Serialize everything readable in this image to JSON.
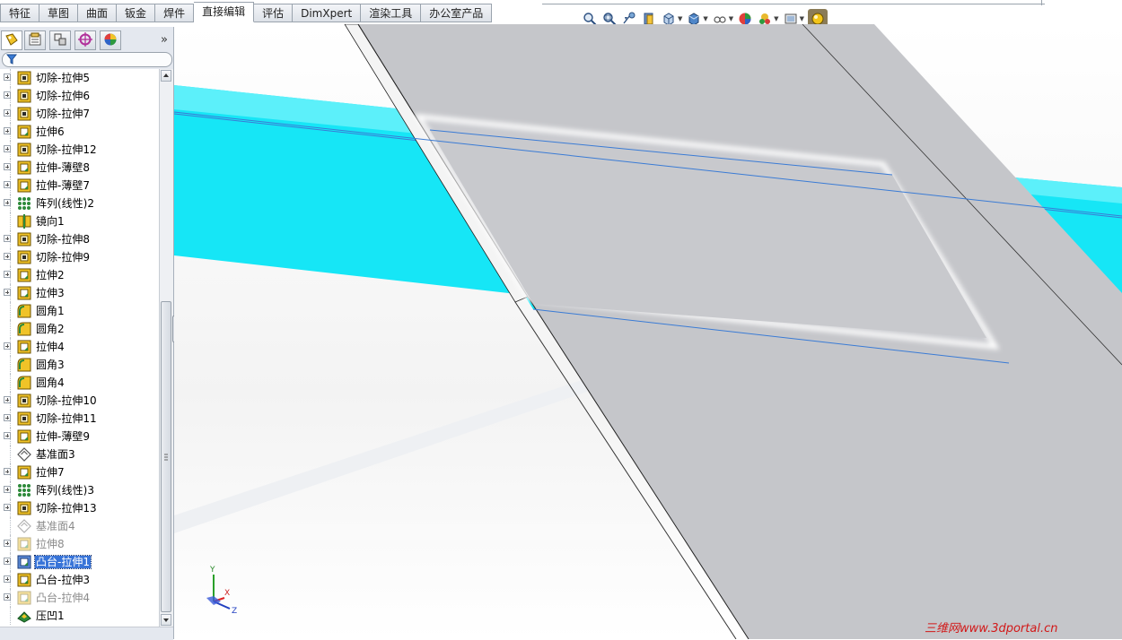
{
  "command_tabs": [
    {
      "label": "特征",
      "active": false
    },
    {
      "label": "草图",
      "active": false
    },
    {
      "label": "曲面",
      "active": false
    },
    {
      "label": "钣金",
      "active": false
    },
    {
      "label": "焊件",
      "active": false
    },
    {
      "label": "直接编辑",
      "active": true
    },
    {
      "label": "评估",
      "active": false
    },
    {
      "label": "DimXpert",
      "active": false
    },
    {
      "label": "渲染工具",
      "active": false
    },
    {
      "label": "办公室产品",
      "active": false
    }
  ],
  "view_toolbar": [
    "zoom-to-fit-icon",
    "zoom-to-area-icon",
    "previous-view-icon",
    "section-view-icon",
    "view-orientation-icon",
    "display-style-icon",
    "hide-show-items-icon",
    "edit-appearance-icon",
    "apply-scene-icon",
    "view-settings-icon",
    "realview-icon"
  ],
  "pane_tabs": [
    "featuremanager-icon",
    "propertymanager-icon",
    "configurationmanager-icon",
    "dimxpert-manager-icon",
    "display-manager-icon"
  ],
  "pane_more": "»",
  "tree": [
    {
      "label": "切除-拉伸5",
      "icon": "cut-extrude",
      "expand": true,
      "dim": false,
      "selected": false
    },
    {
      "label": "切除-拉伸6",
      "icon": "cut-extrude",
      "expand": true,
      "dim": false,
      "selected": false
    },
    {
      "label": "切除-拉伸7",
      "icon": "cut-extrude",
      "expand": true,
      "dim": false,
      "selected": false
    },
    {
      "label": "拉伸6",
      "icon": "extrude",
      "expand": true,
      "dim": false,
      "selected": false
    },
    {
      "label": "切除-拉伸12",
      "icon": "cut-extrude",
      "expand": true,
      "dim": false,
      "selected": false
    },
    {
      "label": "拉伸-薄壁8",
      "icon": "extrude",
      "expand": true,
      "dim": false,
      "selected": false
    },
    {
      "label": "拉伸-薄壁7",
      "icon": "extrude",
      "expand": true,
      "dim": false,
      "selected": false
    },
    {
      "label": "阵列(线性)2",
      "icon": "linear-pattern",
      "expand": true,
      "dim": false,
      "selected": false
    },
    {
      "label": "镜向1",
      "icon": "mirror",
      "expand": false,
      "dim": false,
      "selected": false
    },
    {
      "label": "切除-拉伸8",
      "icon": "cut-extrude",
      "expand": true,
      "dim": false,
      "selected": false
    },
    {
      "label": "切除-拉伸9",
      "icon": "cut-extrude",
      "expand": true,
      "dim": false,
      "selected": false
    },
    {
      "label": "拉伸2",
      "icon": "extrude",
      "expand": true,
      "dim": false,
      "selected": false
    },
    {
      "label": "拉伸3",
      "icon": "extrude",
      "expand": true,
      "dim": false,
      "selected": false
    },
    {
      "label": "圆角1",
      "icon": "fillet",
      "expand": false,
      "dim": false,
      "selected": false
    },
    {
      "label": "圆角2",
      "icon": "fillet",
      "expand": false,
      "dim": false,
      "selected": false
    },
    {
      "label": "拉伸4",
      "icon": "extrude",
      "expand": true,
      "dim": false,
      "selected": false
    },
    {
      "label": "圆角3",
      "icon": "fillet",
      "expand": false,
      "dim": false,
      "selected": false
    },
    {
      "label": "圆角4",
      "icon": "fillet",
      "expand": false,
      "dim": false,
      "selected": false
    },
    {
      "label": "切除-拉伸10",
      "icon": "cut-extrude",
      "expand": true,
      "dim": false,
      "selected": false
    },
    {
      "label": "切除-拉伸11",
      "icon": "cut-extrude",
      "expand": true,
      "dim": false,
      "selected": false
    },
    {
      "label": "拉伸-薄壁9",
      "icon": "extrude",
      "expand": true,
      "dim": false,
      "selected": false
    },
    {
      "label": "基准面3",
      "icon": "plane",
      "expand": false,
      "dim": false,
      "selected": false
    },
    {
      "label": "拉伸7",
      "icon": "extrude",
      "expand": true,
      "dim": false,
      "selected": false
    },
    {
      "label": "阵列(线性)3",
      "icon": "linear-pattern",
      "expand": true,
      "dim": false,
      "selected": false
    },
    {
      "label": "切除-拉伸13",
      "icon": "cut-extrude",
      "expand": true,
      "dim": false,
      "selected": false
    },
    {
      "label": "基准面4",
      "icon": "plane",
      "expand": false,
      "dim": true,
      "selected": false
    },
    {
      "label": "拉伸8",
      "icon": "extrude",
      "expand": true,
      "dim": true,
      "selected": false
    },
    {
      "label": "凸台-拉伸1",
      "icon": "boss-extrude",
      "expand": true,
      "dim": false,
      "selected": true
    },
    {
      "label": "凸台-拉伸3",
      "icon": "extrude",
      "expand": true,
      "dim": false,
      "selected": false
    },
    {
      "label": "凸台-拉伸4",
      "icon": "extrude",
      "expand": true,
      "dim": true,
      "selected": false
    },
    {
      "label": "压凹1",
      "icon": "indent",
      "expand": false,
      "dim": false,
      "selected": false
    }
  ],
  "triad_labels": {
    "x": "X",
    "y": "Y",
    "z": "Z"
  },
  "watermark": "三维网www.3dportal.cn",
  "colors": {
    "cyan_band": "#16e6f6",
    "gray_plate": "#c5c6ca",
    "selection": "#3874d8",
    "edge_line": "#3a7bd5"
  }
}
